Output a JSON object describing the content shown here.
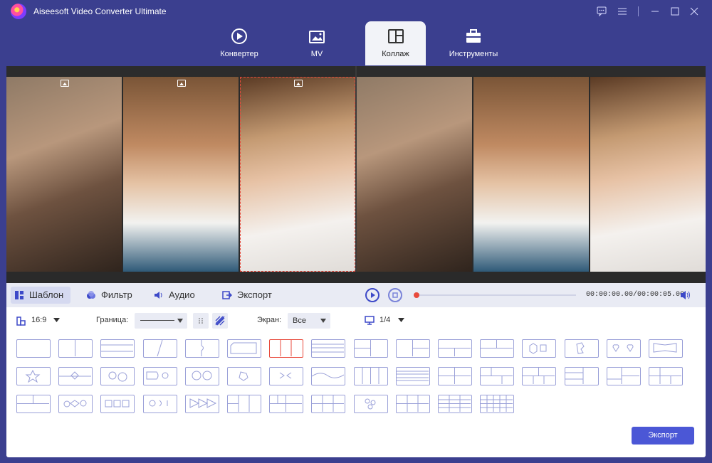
{
  "app": {
    "title": "Aiseesoft Video Converter Ultimate"
  },
  "nav": {
    "tabs": [
      {
        "label": "Конвертер"
      },
      {
        "label": "MV"
      },
      {
        "label": "Коллаж"
      },
      {
        "label": "Инструменты"
      }
    ],
    "active": "Коллаж"
  },
  "toolbar": {
    "tabs": [
      {
        "label": "Шаблон"
      },
      {
        "label": "Фильтр"
      },
      {
        "label": "Аудио"
      },
      {
        "label": "Экспорт"
      }
    ]
  },
  "player": {
    "timecode": "00:00:00.00/00:00:05.00",
    "progress": 0
  },
  "options": {
    "ratio": "16:9",
    "border_label": "Граница:",
    "screen_label": "Экран:",
    "screen_value": "Все",
    "page_value": "1/4"
  },
  "export_button": "Экспорт",
  "colors": {
    "accent": "#4b57d6",
    "header_bg": "#3b3f8f",
    "selection": "#e84a3c"
  }
}
